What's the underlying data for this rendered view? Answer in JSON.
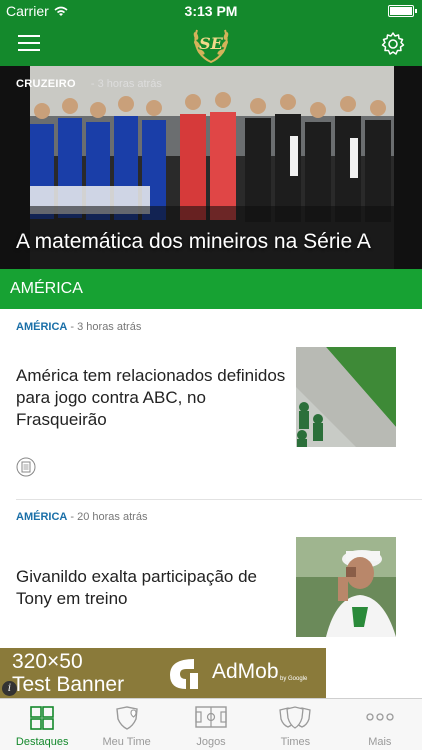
{
  "status_bar": {
    "carrier": "Carrier",
    "time": "3:13 PM"
  },
  "nav": {
    "logo_text": "SE"
  },
  "hero": {
    "category": "CRUZEIRO",
    "time": "- 3 horas atrás",
    "title": "A matemática dos mineiros na Série A"
  },
  "section": {
    "title": "AMÉRICA"
  },
  "news": [
    {
      "category": "AMÉRICA",
      "time": " - 3 horas atrás",
      "title": "América tem relacionados definidos para jogo contra ABC, no Frasqueirão"
    },
    {
      "category": "AMÉRICA",
      "time": " - 20 horas atrás",
      "title": "Givanildo  exalta participação de Tony em  treino"
    }
  ],
  "ad": {
    "line1": "320×50",
    "line2": "Test Banner",
    "brand": "AdMob",
    "by": "by Google"
  },
  "tabs": [
    {
      "label": "Destaques",
      "icon": "grid-icon"
    },
    {
      "label": "Meu Time",
      "icon": "shield-heart-icon"
    },
    {
      "label": "Jogos",
      "icon": "pitch-icon"
    },
    {
      "label": "Times",
      "icon": "shields-icon"
    },
    {
      "label": "Mais",
      "icon": "more-icon"
    }
  ],
  "colors": {
    "primary": "#14892c",
    "section": "#17a233",
    "category_link": "#1a6fa8"
  }
}
